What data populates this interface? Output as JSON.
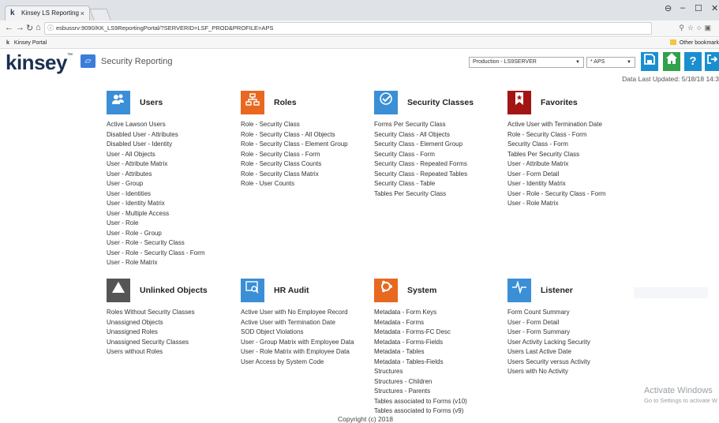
{
  "browser": {
    "tab_title": "Kinsey LS Reporting",
    "tab_close": "×",
    "url": "esbussrv:9090/KK_LS9ReportingPortal/?SERVERID=LSF_PROD&PROFILE=APS",
    "bookmark": "Kinsey Portal",
    "other_bookmarks": "Other bookmark"
  },
  "header": {
    "logo": "kinsey",
    "app_title": "Security Reporting",
    "server_select": "Production - LS9SERVER",
    "profile_select": "* APS",
    "data_updated": "Data Last Updated: 5/18/18 14:3"
  },
  "sections": {
    "users": {
      "title": "Users",
      "links": [
        "Active Lawson Users",
        "Disabled User - Attributes",
        "Disabled User - Identity",
        "User - All Objects",
        "User - Attribute Matrix",
        "User - Attributes",
        "User - Group",
        "User - Identities",
        "User - Identity Matrix",
        "User - Multiple Access",
        "User - Role",
        "User - Role - Group",
        "User - Role - Security Class",
        "User - Role - Security Class - Form",
        "User - Role Matrix"
      ]
    },
    "roles": {
      "title": "Roles",
      "links": [
        "Role - Security Class",
        "Role - Security Class - All Objects",
        "Role - Security Class - Element Group",
        "Role - Security Class - Form",
        "Role - Security Class Counts",
        "Role - Security Class Matrix",
        "Role - User Counts"
      ]
    },
    "security_classes": {
      "title": "Security Classes",
      "links": [
        "Forms Per Security Class",
        "Security Class - All Objects",
        "Security Class - Element Group",
        "Security Class - Form",
        "Security Class - Repeated Forms",
        "Security Class - Repeated Tables",
        "Security Class - Table",
        "Tables Per Security Class"
      ]
    },
    "favorites": {
      "title": "Favorites",
      "links": [
        "Active User with Termination Date",
        "Role - Security Class - Form",
        "Security Class - Form",
        "Tables Per Security Class",
        "User - Attribute Matrix",
        "User - Form Detail",
        "User - Identity Matrix",
        "User - Role - Security Class - Form",
        "User - Role Matrix"
      ]
    },
    "unlinked": {
      "title": "Unlinked Objects",
      "links": [
        "Roles Without Security Classes",
        "Unassigned Objects",
        "Unassigned Roles",
        "Unassigned Security Classes",
        "Users without Roles"
      ]
    },
    "hr_audit": {
      "title": "HR Audit",
      "links": [
        "Active User with No Employee Record",
        "Active User with Termination Date",
        "SOD Object Violations",
        "User - Group Matrix with Employee Data",
        "User - Role Matrix with Employee Data",
        "User Access by System Code"
      ]
    },
    "system": {
      "title": "System",
      "links": [
        "Metadata - Form Keys",
        "Metadata - Forms",
        "Metadata - Forms-FC Desc",
        "Metadata - Forms-Fields",
        "Metadata - Tables",
        "Metadata - Tables-Fields",
        "Structures",
        "Structures - Children",
        "Structures - Parents",
        "Tables associated to Forms (v10)",
        "Tables associated to Forms (v9)"
      ]
    },
    "listener": {
      "title": "Listener",
      "links": [
        "Form Count Summary",
        "User - Form Detail",
        "User - Form Summary",
        "User Activity Lacking Security",
        "Users Last Active Date",
        "Users Security versus Activity",
        "Users with No Activity"
      ]
    }
  },
  "watermark": {
    "line1": "Activate Windows",
    "line2": "Go to Settings to activate W"
  },
  "footer": {
    "copyright": "Copyright (c) 2018"
  },
  "colors": {
    "users": "#3a8fd6",
    "roles": "#e8681f",
    "security_classes": "#3a8fd6",
    "favorites": "#a31515",
    "unlinked": "#555555",
    "hr_audit": "#3a8fd6",
    "system": "#e8681f",
    "listener": "#3a8fd6",
    "header_button": "#1a8fd0",
    "home_button": "#33a04a"
  }
}
